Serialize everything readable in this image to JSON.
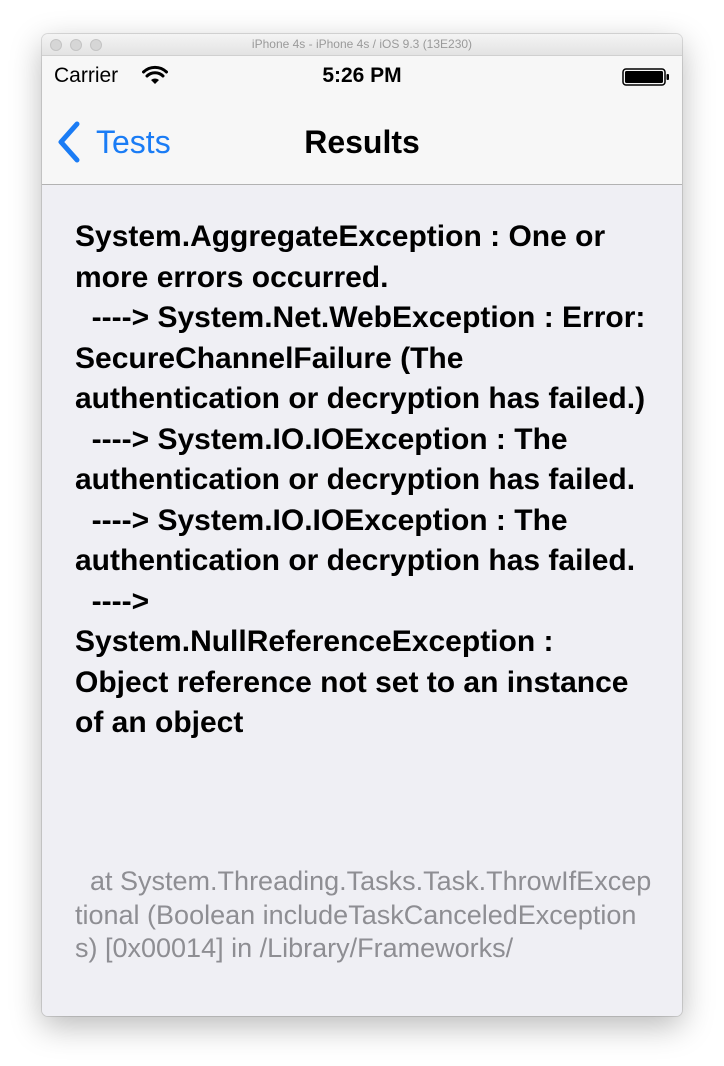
{
  "window": {
    "title": "iPhone 4s - iPhone 4s / iOS 9.3 (13E230)"
  },
  "status_bar": {
    "carrier": "Carrier",
    "time": "5:26 PM",
    "icons": [
      "wifi-icon",
      "battery-icon"
    ]
  },
  "nav_bar": {
    "back_label": "Tests",
    "title": "Results",
    "back_icon": "chevron-left-icon"
  },
  "result": {
    "message": "System.AggregateException : One or more errors occurred.\n  ----> System.Net.WebException : Error: SecureChannelFailure (The authentication or decryption has failed.)\n  ----> System.IO.IOException : The authentication or decryption has failed.\n  ----> System.IO.IOException : The authentication or decryption has failed.\n  ---->\nSystem.NullReferenceException : Object reference not set to an instance of an object",
    "stack_trace": "  at System.Threading.Tasks.Task.ThrowIfExceptional (Boolean includeTaskCanceledExceptions) [0x00014] in /Library/Frameworks/"
  },
  "colors": {
    "accent": "#1a7cf5",
    "background": "#efeff4",
    "bar": "#f7f7f7",
    "trace_text": "#8e8e93"
  }
}
